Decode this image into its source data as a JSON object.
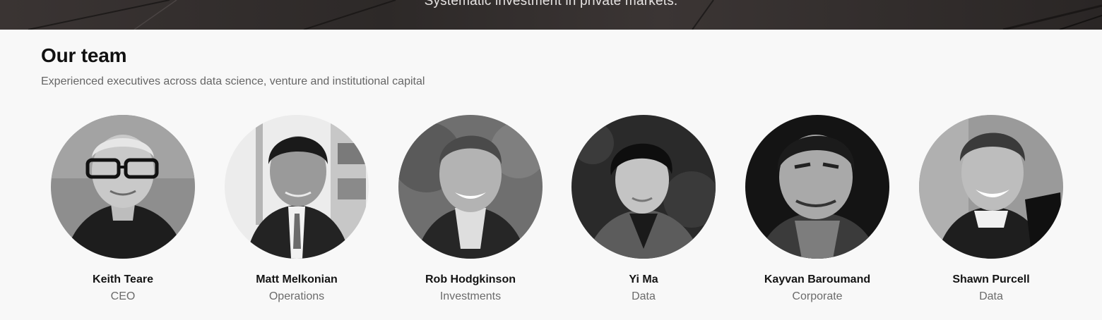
{
  "hero": {
    "tagline": "Systematic investment in private markets."
  },
  "team": {
    "title": "Our team",
    "subtitle": "Experienced executives across data science, venture and institutional capital",
    "members": [
      {
        "name": "Keith Teare",
        "role": "CEO"
      },
      {
        "name": "Matt Melkonian",
        "role": "Operations"
      },
      {
        "name": "Rob Hodgkinson",
        "role": "Investments"
      },
      {
        "name": "Yi Ma",
        "role": "Data"
      },
      {
        "name": "Kayvan Baroumand",
        "role": "Corporate"
      },
      {
        "name": "Shawn Purcell",
        "role": "Data"
      }
    ]
  }
}
